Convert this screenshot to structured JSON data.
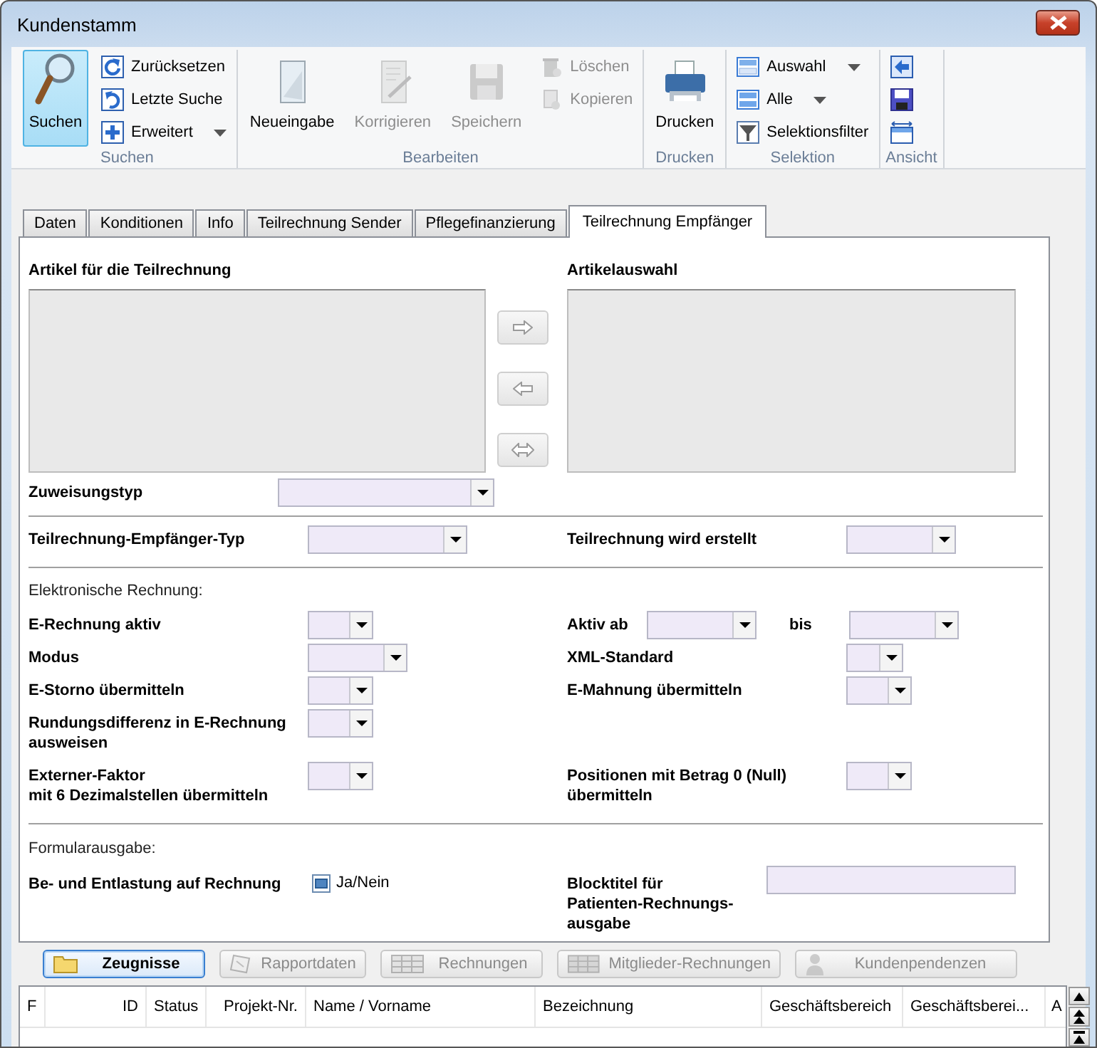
{
  "window": {
    "title": "Kundenstamm"
  },
  "ribbon": {
    "groups": [
      {
        "label": "Suchen",
        "items": [
          {
            "kind": "large",
            "label": "Suchen",
            "selected": true,
            "disabled": false
          },
          {
            "kind": "small",
            "label": "Zurücksetzen",
            "selected": false,
            "disabled": false,
            "dropdown": false
          },
          {
            "kind": "small",
            "label": "Letzte Suche",
            "selected": false,
            "disabled": false,
            "dropdown": false
          },
          {
            "kind": "small",
            "label": "Erweitert",
            "selected": false,
            "disabled": false,
            "dropdown": true
          }
        ]
      },
      {
        "label": "Bearbeiten",
        "items": [
          {
            "kind": "large",
            "label": "Neueingabe",
            "selected": false,
            "disabled": false
          },
          {
            "kind": "large",
            "label": "Korrigieren",
            "selected": false,
            "disabled": true
          },
          {
            "kind": "large",
            "label": "Speichern",
            "selected": false,
            "disabled": true
          },
          {
            "kind": "small",
            "label": "Löschen",
            "selected": false,
            "disabled": true,
            "dropdown": false
          },
          {
            "kind": "small",
            "label": "Kopieren",
            "selected": false,
            "disabled": true,
            "dropdown": false
          }
        ]
      },
      {
        "label": "Drucken",
        "items": [
          {
            "kind": "large",
            "label": "Drucken",
            "selected": false,
            "disabled": false
          }
        ]
      },
      {
        "label": "Selektion",
        "items": [
          {
            "kind": "small",
            "label": "Auswahl",
            "selected": false,
            "disabled": false,
            "dropdown": true
          },
          {
            "kind": "small",
            "label": "Alle",
            "selected": false,
            "disabled": false,
            "dropdown": true
          },
          {
            "kind": "small",
            "label": "Selektionsfilter",
            "selected": false,
            "disabled": false,
            "dropdown": false
          }
        ]
      },
      {
        "label": "Ansicht",
        "items": [
          {
            "kind": "icon",
            "selected": false,
            "disabled": false
          },
          {
            "kind": "icon",
            "selected": false,
            "disabled": false
          },
          {
            "kind": "icon",
            "selected": false,
            "disabled": false
          }
        ]
      }
    ]
  },
  "tabs": [
    {
      "label": "Daten",
      "selected": false
    },
    {
      "label": "Konditionen",
      "selected": false
    },
    {
      "label": "Info",
      "selected": false
    },
    {
      "label": "Teilrechnung Sender",
      "selected": false
    },
    {
      "label": "Pflegefinanzierung",
      "selected": false
    },
    {
      "label": "Teilrechnung Empfänger",
      "selected": true
    }
  ],
  "form": {
    "list_left_label": "Artikel für die Teilrechnung",
    "list_right_label": "Artikelauswahl",
    "transfer_buttons": [
      {
        "disabled": true
      },
      {
        "disabled": true
      },
      {
        "disabled": true
      }
    ],
    "assignment": {
      "label": "Zuweisungstyp"
    },
    "sections": [
      {
        "rows": [
          {
            "left": [
              {
                "kind": "label",
                "text": "Teilrechnung-Empfänger-Typ"
              },
              {
                "kind": "combo"
              }
            ],
            "right": [
              {
                "kind": "label",
                "text": "Teilrechnung wird erstellt"
              },
              {
                "kind": "combo"
              }
            ]
          }
        ]
      },
      {
        "title": "Elektronische Rechnung:",
        "rows": [
          {
            "left": [
              {
                "kind": "label",
                "text": "E-Rechnung aktiv"
              },
              {
                "kind": "combo"
              }
            ],
            "right": [
              {
                "kind": "label",
                "text": "Aktiv ab"
              },
              {
                "kind": "combo"
              },
              {
                "kind": "label",
                "text": "bis"
              },
              {
                "kind": "combo"
              }
            ]
          },
          {
            "left": [
              {
                "kind": "label",
                "text": "Modus"
              },
              {
                "kind": "combo"
              }
            ],
            "right": [
              {
                "kind": "label",
                "text": "XML-Standard"
              },
              {
                "kind": "combo"
              }
            ]
          },
          {
            "left": [
              {
                "kind": "label",
                "text": "E-Storno übermitteln"
              },
              {
                "kind": "combo"
              }
            ],
            "right": [
              {
                "kind": "label",
                "text": "E-Mahnung übermitteln"
              },
              {
                "kind": "combo"
              }
            ]
          },
          {
            "left": [
              {
                "kind": "label",
                "text": "Rundungsdifferenz in E-Rechnung\nausweisen"
              },
              {
                "kind": "combo"
              }
            ],
            "right": []
          },
          {
            "left": [
              {
                "kind": "label",
                "text": "Externer-Faktor\nmit 6 Dezimalstellen übermitteln"
              },
              {
                "kind": "combo"
              }
            ],
            "right": [
              {
                "kind": "label",
                "text": "Positionen mit Betrag 0 (Null)\nübermitteln"
              },
              {
                "kind": "combo"
              }
            ]
          }
        ]
      },
      {
        "title": "Formularausgabe:",
        "rows": [
          {
            "left": [
              {
                "kind": "label",
                "text": "Be- und Entlastung auf Rechnung"
              },
              {
                "kind": "checkbox",
                "text": "Ja/Nein",
                "indeterminate": true
              }
            ],
            "right": [
              {
                "kind": "label",
                "text": "Blocktitel für\nPatienten-Rechnungs-\nausgabe"
              },
              {
                "kind": "text_field"
              }
            ]
          }
        ]
      }
    ]
  },
  "actions": [
    {
      "label": "Zeugnisse",
      "disabled": false,
      "focused": true
    },
    {
      "label": "Rapportdaten",
      "disabled": true,
      "focused": false
    },
    {
      "label": "Rechnungen",
      "disabled": true,
      "focused": false
    },
    {
      "label": "Mitglieder-Rechnungen",
      "disabled": true,
      "focused": false
    },
    {
      "label": "Kundenpendenzen",
      "disabled": true,
      "focused": false
    }
  ],
  "table": {
    "columns": [
      "F",
      "ID",
      "Status",
      "Projekt-Nr.",
      "Name / Vorname",
      "Bezeichnung",
      "Geschäftsbereich",
      "Geschäftsberei...",
      "A"
    ]
  }
}
